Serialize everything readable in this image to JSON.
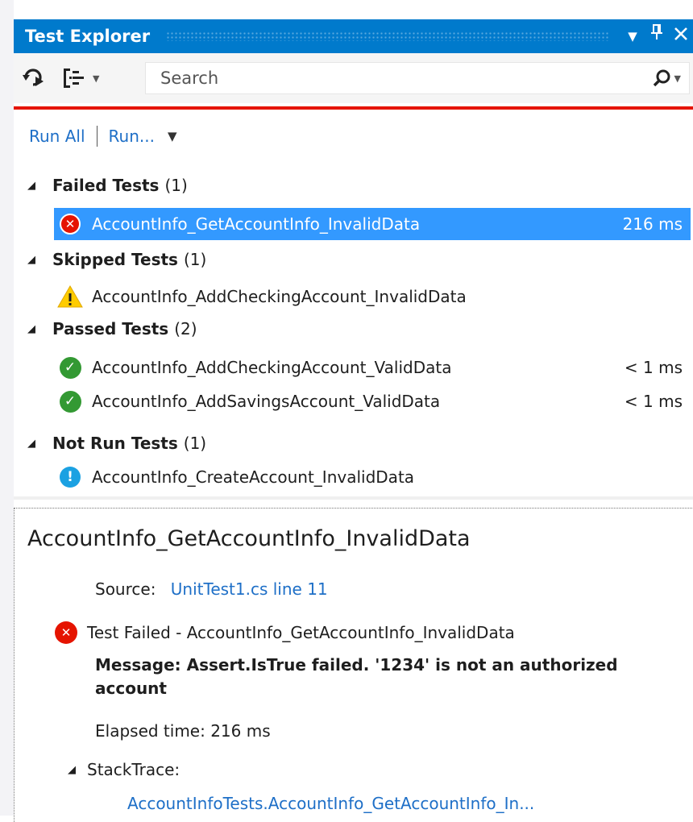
{
  "window": {
    "title": "Test Explorer",
    "dropdown_glyph": "▼",
    "pin_glyph": "📌",
    "close_glyph": "✕"
  },
  "toolbar": {
    "search_placeholder": "Search",
    "group_by_icon": "group-by-icon",
    "refresh_icon": "run-refresh-icon",
    "search_icon": "search-icon"
  },
  "actions": {
    "run_all": "Run All",
    "run": "Run..."
  },
  "groups": {
    "failed": {
      "name": "Failed Tests",
      "count": "(1)",
      "tests": [
        {
          "name": "AccountInfo_GetAccountInfo_InvalidData",
          "duration": "216 ms",
          "status": "failed",
          "selected": true
        }
      ]
    },
    "skipped": {
      "name": "Skipped Tests",
      "count": "(1)",
      "tests": [
        {
          "name": "AccountInfo_AddCheckingAccount_InvalidData",
          "duration": "",
          "status": "skipped"
        }
      ]
    },
    "passed": {
      "name": "Passed Tests",
      "count": "(2)",
      "tests": [
        {
          "name": "AccountInfo_AddCheckingAccount_ValidData",
          "duration": "< 1 ms",
          "status": "passed"
        },
        {
          "name": "AccountInfo_AddSavingsAccount_ValidData",
          "duration": "< 1 ms",
          "status": "passed"
        }
      ]
    },
    "notrun": {
      "name": "Not Run Tests",
      "count": "(1)",
      "tests": [
        {
          "name": "AccountInfo_CreateAccount_InvalidData",
          "duration": "",
          "status": "not-run"
        }
      ]
    }
  },
  "detail": {
    "title": "AccountInfo_GetAccountInfo_InvalidData",
    "source_label": "Source:",
    "source_link": "UnitTest1.cs line 11",
    "status_text": "Test Failed - AccountInfo_GetAccountInfo_InvalidData",
    "message": "Message: Assert.IsTrue failed. '1234' is not an authorized account",
    "elapsed": "Elapsed time: 216 ms",
    "stacktrace_label": "StackTrace:",
    "stack_frame": "AccountInfoTests.AccountInfo_GetAccountInfo_In..."
  },
  "colors": {
    "accent": "#007acc",
    "fail": "#e51400",
    "pass": "#339933",
    "warn": "#ffcc00",
    "info": "#1ba1e2",
    "selection": "#3399ff",
    "link": "#1e6fc7"
  }
}
